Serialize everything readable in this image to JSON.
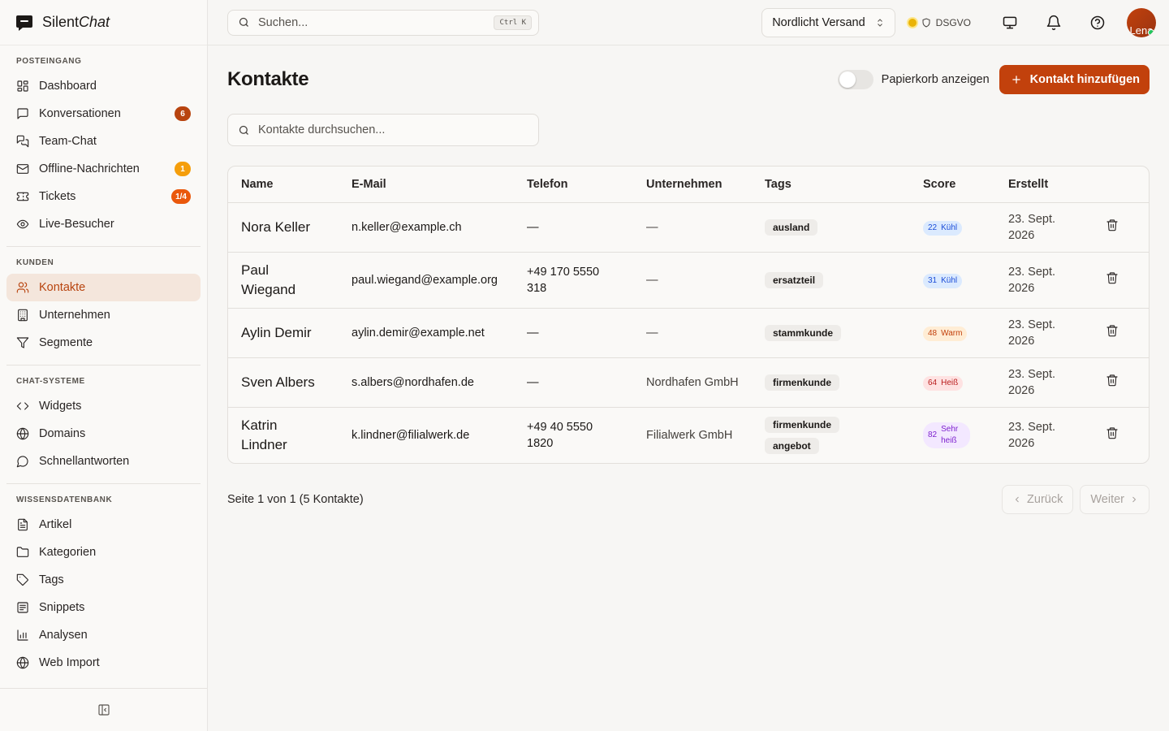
{
  "app": {
    "brand_plain": "Silent",
    "brand_italic": "Chat"
  },
  "sidebar": {
    "sections": [
      {
        "heading": "POSTEINGANG",
        "items": [
          {
            "label": "Dashboard",
            "icon": "dashboard-icon"
          },
          {
            "label": "Konversationen",
            "icon": "message-square-icon",
            "badge": "6",
            "badge_color": "#b8440f"
          },
          {
            "label": "Team-Chat",
            "icon": "messages-icon"
          },
          {
            "label": "Offline-Nachrichten",
            "icon": "mail-icon",
            "badge": "1",
            "badge_color": "#f59e0b"
          },
          {
            "label": "Tickets",
            "icon": "ticket-icon",
            "badge": "1/4",
            "badge_color": "#ea580c"
          },
          {
            "label": "Live-Besucher",
            "icon": "eye-icon"
          }
        ]
      },
      {
        "heading": "KUNDEN",
        "items": [
          {
            "label": "Kontakte",
            "icon": "users-icon",
            "active": true
          },
          {
            "label": "Unternehmen",
            "icon": "building-icon"
          },
          {
            "label": "Segmente",
            "icon": "filter-icon"
          }
        ]
      },
      {
        "heading": "CHAT-SYSTEME",
        "items": [
          {
            "label": "Widgets",
            "icon": "code-icon"
          },
          {
            "label": "Domains",
            "icon": "globe-icon"
          },
          {
            "label": "Schnellantworten",
            "icon": "message-circle-icon"
          }
        ]
      },
      {
        "heading": "WISSENSDATENBANK",
        "items": [
          {
            "label": "Artikel",
            "icon": "file-text-icon"
          },
          {
            "label": "Kategorien",
            "icon": "folder-icon"
          },
          {
            "label": "Tags",
            "icon": "tag-icon"
          },
          {
            "label": "Snippets",
            "icon": "snippet-icon"
          },
          {
            "label": "Analysen",
            "icon": "bar-chart-icon"
          },
          {
            "label": "Web Import",
            "icon": "globe-icon"
          }
        ]
      }
    ]
  },
  "topbar": {
    "search_placeholder": "Suchen...",
    "shortcut": "Ctrl K",
    "org": "Nordlicht Versand",
    "compliance": "DSGVO",
    "avatar_text": "Lena"
  },
  "page": {
    "title": "Kontakte",
    "trash_toggle_label": "Papierkorb anzeigen",
    "add_button": "Kontakt hinzufügen",
    "filter_placeholder": "Kontakte durchsuchen..."
  },
  "table": {
    "columns": [
      "Name",
      "E-Mail",
      "Telefon",
      "Unternehmen",
      "Tags",
      "Score",
      "Erstellt"
    ],
    "rows": [
      {
        "name": "Nora Keller",
        "email": "n.keller@example.ch",
        "phone": "—",
        "company": "—",
        "tags": [
          "ausland"
        ],
        "score": "22",
        "score_label": "Kühl",
        "score_bg": "#dbeafe",
        "score_fg": "#1d4ed8",
        "created": "23. Sept. 2026"
      },
      {
        "name": "Paul Wiegand",
        "email": "paul.wiegand@example.org",
        "phone": "+49 170 5550 318",
        "company": "—",
        "tags": [
          "ersatzteil"
        ],
        "score": "31",
        "score_label": "Kühl",
        "score_bg": "#dbeafe",
        "score_fg": "#1d4ed8",
        "created": "23. Sept. 2026"
      },
      {
        "name": "Aylin Demir",
        "email": "aylin.demir@example.net",
        "phone": "—",
        "company": "—",
        "tags": [
          "stammkunde"
        ],
        "score": "48",
        "score_label": "Warm",
        "score_bg": "#ffedd5",
        "score_fg": "#c2410c",
        "created": "23. Sept. 2026"
      },
      {
        "name": "Sven Albers",
        "email": "s.albers@nordhafen.de",
        "phone": "—",
        "company": "Nordhafen GmbH",
        "tags": [
          "firmenkunde"
        ],
        "score": "64",
        "score_label": "Heiß",
        "score_bg": "#fee2e2",
        "score_fg": "#b91c1c",
        "created": "23. Sept. 2026"
      },
      {
        "name": "Katrin Lindner",
        "email": "k.lindner@filialwerk.de",
        "phone": "+49 40 5550 1820",
        "company": "Filialwerk GmbH",
        "tags": [
          "firmenkunde",
          "angebot"
        ],
        "score": "82",
        "score_label": "Sehr heiß",
        "score_bg": "#f3e8ff",
        "score_fg": "#7e22ce",
        "created": "23. Sept. 2026"
      }
    ]
  },
  "pagination": {
    "info": "Seite 1 von 1 (5 Kontakte)",
    "prev": "Zurück",
    "next": "Weiter"
  }
}
